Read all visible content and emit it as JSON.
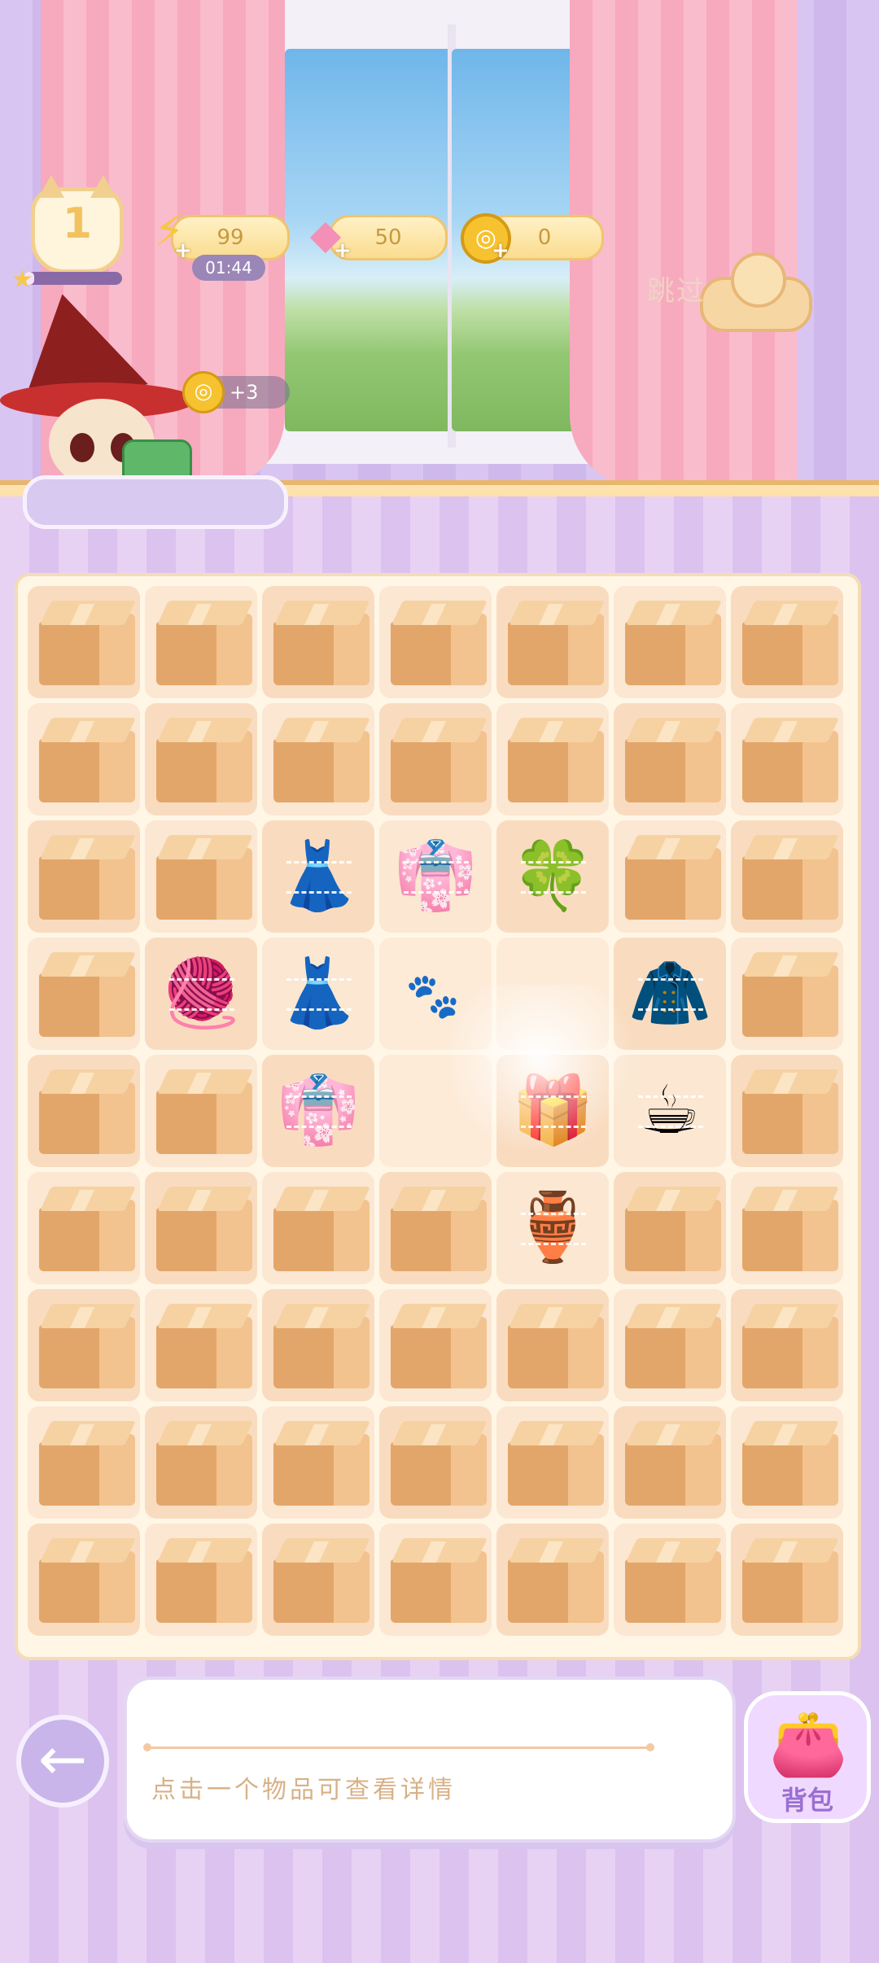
{
  "hud": {
    "level": "1",
    "xp_progress": 0.1,
    "energy": {
      "icon": "lightning-icon",
      "value": "99",
      "timer": "01:44"
    },
    "gems": {
      "icon": "pink-gem-icon",
      "value": "50"
    },
    "coins": {
      "icon": "gold-coin-icon",
      "value": "0"
    },
    "skip_label": "跳过"
  },
  "character": {
    "reward_icon": "gold-coin-icon",
    "reward_text": "+3",
    "request_item": "green-sweater-icon"
  },
  "board": {
    "cols": 7,
    "rows": 9,
    "cells": [
      [
        "box",
        "box",
        "box",
        "box",
        "box",
        "box",
        "box"
      ],
      [
        "box",
        "box",
        "box",
        "box",
        "box",
        "box",
        "box"
      ],
      [
        "box",
        "box",
        "gray-dress",
        "blue-dress",
        "green-bush",
        "box",
        "box"
      ],
      [
        "box",
        "red-cushion",
        "lavender-dress",
        "paw-empty",
        "empty",
        "green-sweater",
        "box"
      ],
      [
        "box",
        "box",
        "blue-dress",
        "empty",
        "energy-gift",
        "teacup",
        "box"
      ],
      [
        "box",
        "box",
        "box",
        "box",
        "honey-jar",
        "box",
        "box"
      ],
      [
        "box",
        "box",
        "box",
        "box",
        "box",
        "box",
        "box"
      ],
      [
        "box",
        "box",
        "box",
        "box",
        "box",
        "box",
        "box"
      ],
      [
        "box",
        "box",
        "box",
        "box",
        "box",
        "box",
        "box"
      ]
    ],
    "item_glyphs": {
      "gray-dress": "👗",
      "blue-dress": "👘",
      "green-bush": "🍀",
      "red-cushion": "🧶",
      "lavender-dress": "👗",
      "green-sweater": "🧥",
      "energy-gift": "🎁",
      "teacup": "☕",
      "honey-jar": "🏺"
    }
  },
  "bottom": {
    "back_icon": "arrow-left-icon",
    "info_hint": "点击一个物品可查看详情",
    "bag_icon": "purse-icon",
    "bag_label": "背包"
  }
}
